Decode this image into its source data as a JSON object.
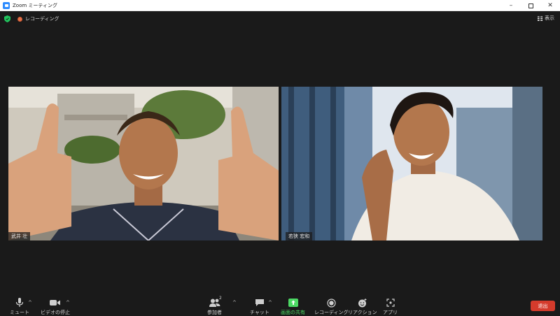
{
  "window": {
    "title": "Zoom ミーティング",
    "controls": {
      "minimize": "–",
      "close": "✕"
    }
  },
  "status": {
    "recording_label": "レコーディング",
    "view_label": "表示"
  },
  "participants": [
    {
      "name": "武井 壮"
    },
    {
      "name": "若狭 宏和"
    }
  ],
  "toolbar": {
    "mute": "ミュート",
    "video": "ビデオの停止",
    "participants": "参加者",
    "participants_count": "2",
    "chat": "チャット",
    "share": "画面の共有",
    "record": "レコーディング",
    "reactions": "リアクション",
    "apps": "アプリ",
    "leave": "退出",
    "caret": "^"
  },
  "colors": {
    "background": "#1a1a1a",
    "share_accent": "#4cd964",
    "leave": "#d43b2c",
    "security_shield": "#22c55e"
  }
}
